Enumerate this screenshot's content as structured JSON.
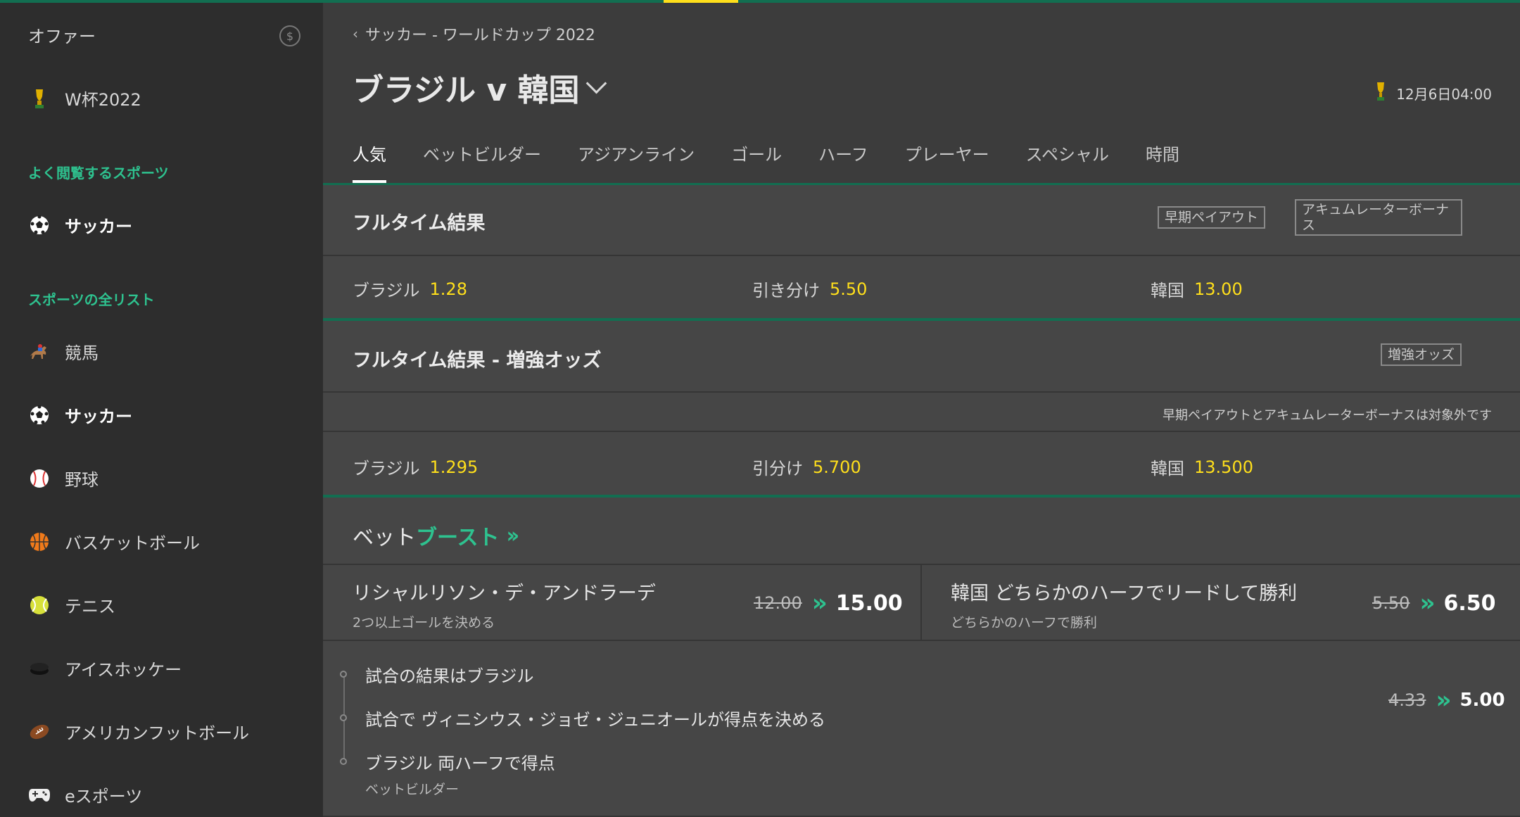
{
  "colors": {
    "accent_green": "#2ec28f",
    "bar_green": "#126e51",
    "odds_yellow": "#ffdf1b",
    "bg": "#3c3c3c",
    "sidebar_bg": "#2d2d2d"
  },
  "sidebar": {
    "offers_label": "オファー",
    "offers_badge": "$",
    "featured": {
      "label": "W杯2022",
      "icon": "trophy-icon"
    },
    "popular_heading": "よく閲覧するスポーツ",
    "popular_items": [
      {
        "label": "サッカー",
        "icon": "soccer-ball-icon"
      }
    ],
    "all_heading": "スポーツの全リスト",
    "all_items": [
      {
        "label": "競馬",
        "icon": "horse-racing-icon"
      },
      {
        "label": "サッカー",
        "icon": "soccer-ball-icon"
      },
      {
        "label": "野球",
        "icon": "baseball-icon"
      },
      {
        "label": "バスケットボール",
        "icon": "basketball-icon"
      },
      {
        "label": "テニス",
        "icon": "tennis-ball-icon"
      },
      {
        "label": "アイスホッケー",
        "icon": "hockey-puck-icon"
      },
      {
        "label": "アメリカンフットボール",
        "icon": "football-icon"
      },
      {
        "label": "eスポーツ",
        "icon": "gamepad-icon"
      }
    ]
  },
  "header": {
    "breadcrumb": "サッカー - ワールドカップ 2022",
    "title": "ブラジル v 韓国",
    "kickoff": "12月6日04:00"
  },
  "tabs": [
    "人気",
    "ベットビルダー",
    "アジアンライン",
    "ゴール",
    "ハーフ",
    "プレーヤー",
    "スペシャル",
    "時間"
  ],
  "fulltime": {
    "title": "フルタイム結果",
    "tag_early": "早期ペイアウト",
    "tag_acca": "アキュムレーターボーナス",
    "selections": [
      {
        "name": "ブラジル",
        "odds": "1.28"
      },
      {
        "name": "引き分け",
        "odds": "5.50"
      },
      {
        "name": "韓国",
        "odds": "13.00"
      }
    ]
  },
  "enhanced": {
    "title": "フルタイム結果 - 増強オッズ",
    "tag": "増強オッズ",
    "note": "早期ペイアウトとアキュムレーターボーナスは対象外です",
    "selections": [
      {
        "name": "ブラジル",
        "odds": "1.295"
      },
      {
        "name": "引分け",
        "odds": "5.700"
      },
      {
        "name": "韓国",
        "odds": "13.500"
      }
    ]
  },
  "betboost": {
    "prefix": "ベット",
    "highlight": "ブースト",
    "items": [
      {
        "name": "リシャルリソン・デ・アンドラーデ",
        "sub": "2つ以上ゴールを決める",
        "old": "12.00",
        "new": "15.00"
      },
      {
        "name": "韓国 どちらかのハーフでリードして勝利",
        "sub": "どちらかのハーフで勝利",
        "old": "5.50",
        "new": "6.50"
      }
    ],
    "builder": {
      "legs": [
        "試合の結果はブラジル",
        "試合で ヴィニシウス・ジョゼ・ジュニオールが得点を決める",
        "ブラジル 両ハーフで得点"
      ],
      "label": "ベットビルダー",
      "old": "4.33",
      "new": "5.00"
    }
  }
}
